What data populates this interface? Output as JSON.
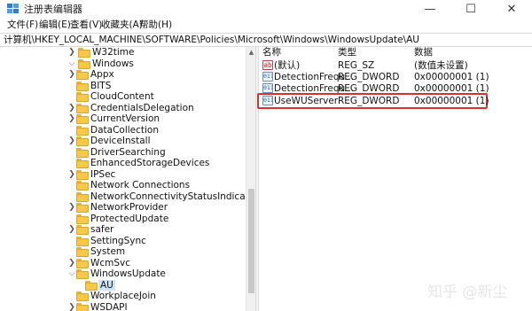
{
  "window": {
    "title": "注册表编辑器",
    "minimize_glyph": "—",
    "maximize_glyph": "☐",
    "close_glyph": "✕"
  },
  "menu": [
    "文件(F)",
    "编辑(E)",
    "查看(V)",
    "收藏夹(A)",
    "帮助(H)"
  ],
  "address": "计算机\\HKEY_LOCAL_MACHINE\\SOFTWARE\\Policies\\Microsoft\\Windows\\WindowsUpdate\\AU",
  "tree": {
    "items": [
      {
        "label": "W32time",
        "expanded": false
      },
      {
        "label": "Windows",
        "expanded": true
      },
      {
        "label": "Appx",
        "expanded": false
      },
      {
        "label": "BITS",
        "expanded": false
      },
      {
        "label": "CloudContent",
        "expanded": false
      },
      {
        "label": "CredentialsDelegation",
        "expanded": false
      },
      {
        "label": "CurrentVersion",
        "expanded": false
      },
      {
        "label": "DataCollection",
        "expanded": false
      },
      {
        "label": "DeviceInstall",
        "expanded": false
      },
      {
        "label": "DriverSearching",
        "expanded": false
      },
      {
        "label": "EnhancedStorageDevices",
        "expanded": false
      },
      {
        "label": "IPSec",
        "expanded": false
      },
      {
        "label": "Network Connections",
        "expanded": false
      },
      {
        "label": "NetworkConnectivityStatusIndicator",
        "expanded": false
      },
      {
        "label": "NetworkProvider",
        "expanded": false
      },
      {
        "label": "ProtectedUpdate",
        "expanded": false
      },
      {
        "label": "safer",
        "expanded": false
      },
      {
        "label": "SettingSync",
        "expanded": false
      },
      {
        "label": "System",
        "expanded": false
      },
      {
        "label": "WcmSvc",
        "expanded": false
      },
      {
        "label": "WindowsUpdate",
        "expanded": true
      },
      {
        "label": "AU",
        "expanded": false,
        "selected": true
      },
      {
        "label": "WorkplaceJoin",
        "expanded": false
      },
      {
        "label": "WSDAPI",
        "expanded": false
      }
    ]
  },
  "columns": {
    "name": "名称",
    "type": "类型",
    "data": "数据"
  },
  "values": [
    {
      "icon": "ab",
      "name": "(默认)",
      "type": "REG_SZ",
      "data": "(数值未设置)"
    },
    {
      "icon": "011",
      "name": "DetectionFrequ...",
      "type": "REG_DWORD",
      "data": "0x00000001 (1)"
    },
    {
      "icon": "011",
      "name": "DetectionFrequ...",
      "type": "REG_DWORD",
      "data": "0x00000001 (1)"
    },
    {
      "icon": "011",
      "name": "UseWUServer",
      "type": "REG_DWORD",
      "data": "0x00000001 (1)",
      "highlighted": true
    }
  ],
  "watermark": "知乎 @新尘",
  "colors": {
    "selection": "#cce4f7",
    "highlight_border": "#d9322b",
    "folder": "#f6c94a"
  }
}
